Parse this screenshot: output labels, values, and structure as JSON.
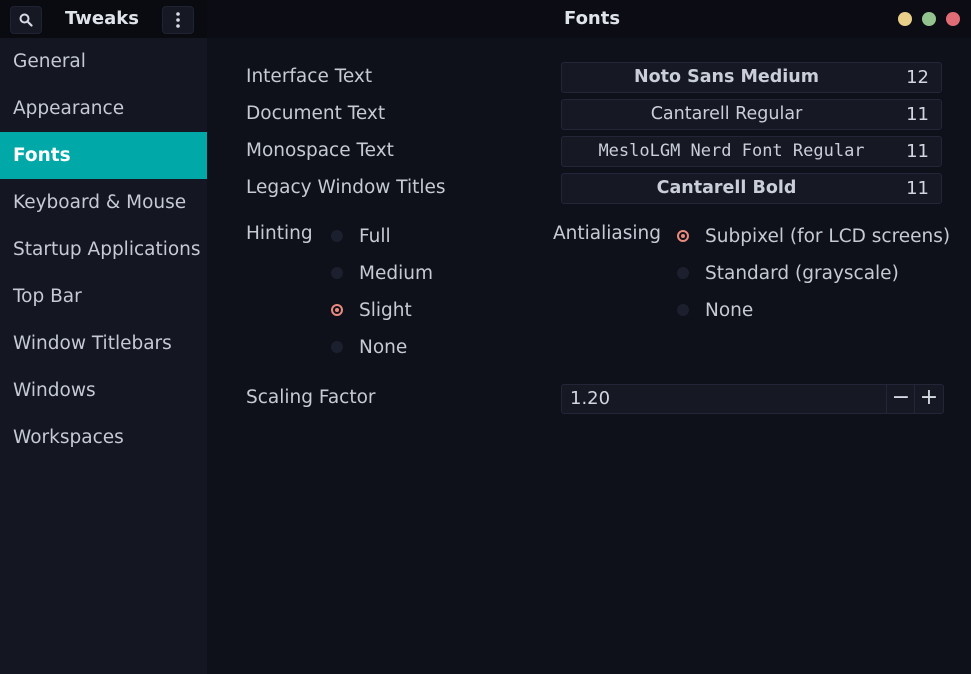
{
  "header": {
    "app_title": "Tweaks",
    "window_title": "Fonts",
    "search_icon": "search-icon",
    "menu_icon": "vertical-dots-icon",
    "window_controls": [
      {
        "name": "minimize",
        "color": "#e8cf8a"
      },
      {
        "name": "maximize",
        "color": "#93c48f"
      },
      {
        "name": "close",
        "color": "#e06c75"
      }
    ]
  },
  "sidebar": {
    "items": [
      {
        "label": "General"
      },
      {
        "label": "Appearance"
      },
      {
        "label": "Fonts",
        "active": true
      },
      {
        "label": "Keyboard & Mouse"
      },
      {
        "label": "Startup Applications"
      },
      {
        "label": "Top Bar"
      },
      {
        "label": "Window Titlebars"
      },
      {
        "label": "Windows"
      },
      {
        "label": "Workspaces"
      }
    ]
  },
  "fonts": {
    "interface": {
      "label": "Interface Text",
      "font": "Noto Sans Medium",
      "size": "12"
    },
    "document": {
      "label": "Document Text",
      "font": "Cantarell Regular",
      "size": "11"
    },
    "monospace": {
      "label": "Monospace Text",
      "font": "MesloLGM Nerd Font Regular",
      "size": "11"
    },
    "legacy": {
      "label": "Legacy Window Titles",
      "font": "Cantarell Bold",
      "size": "11"
    }
  },
  "hinting": {
    "label": "Hinting",
    "options": [
      "Full",
      "Medium",
      "Slight",
      "None"
    ],
    "selected": "Slight"
  },
  "antialiasing": {
    "label": "Antialiasing",
    "options": [
      "Subpixel (for LCD screens)",
      "Standard (grayscale)",
      "None"
    ],
    "selected": "Subpixel (for LCD screens)"
  },
  "scaling": {
    "label": "Scaling Factor",
    "value": "1.20",
    "decrement": "−",
    "increment": "+"
  },
  "colors": {
    "accent": "#00a8a8",
    "radio_selected": "#e88a7d"
  }
}
